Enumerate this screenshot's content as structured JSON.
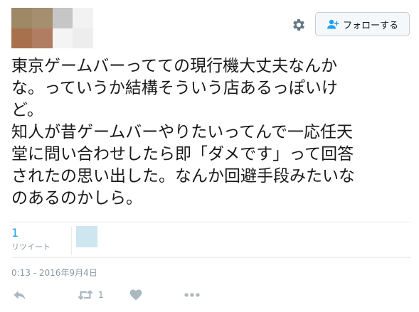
{
  "header": {
    "avatar_pixels": [
      "#9f8866",
      "#a68f6e",
      "#c6c6c6",
      "#f2f2f2",
      "#ffffff",
      "#a8714d",
      "#b07d62",
      "#f4f4f4",
      "#ededed",
      "#ffffff"
    ],
    "settings_icon": "gear-icon",
    "follow_button": {
      "icon": "person-plus-icon",
      "label": "フォローする"
    }
  },
  "tweet": {
    "lines": [
      "東京ゲームバーってての現行機大丈夫なんか",
      "な。っていうか結構そういう店あるっぽいけ",
      "ど。",
      "知人が昔ゲームバーやりたいってんで一応任天",
      "堂に問い合わせしたら即「ダメです」って回答",
      "されたの思い出した。なんか回避手段みたいな",
      "のあるのかしら。"
    ]
  },
  "stats": {
    "retweet_count": "1",
    "retweet_label": "リツイート"
  },
  "timestamp": "0:13 - 2016年9月4日",
  "actions": {
    "reply_icon": "reply-icon",
    "retweet_icon": "retweet-icon",
    "retweet_count": "1",
    "like_icon": "heart-icon",
    "more_icon": "more-icon"
  },
  "colors": {
    "accent": "#1da1f2",
    "muted": "#8899a6",
    "icon_gray": "#aab8c2",
    "divider": "#e6ecf0"
  }
}
